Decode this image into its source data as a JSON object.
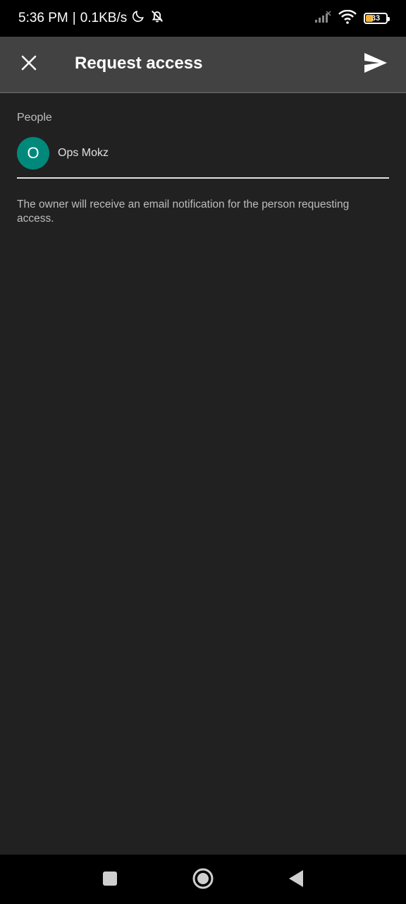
{
  "status_bar": {
    "time": "5:36 PM",
    "separator": "|",
    "network_speed": "0.1KB/s",
    "icons": [
      "moon-icon",
      "bell-off-icon",
      "signal-icon",
      "wifi-icon",
      "battery-icon"
    ],
    "battery_level": "33",
    "battery_color": "#f2b233"
  },
  "app_bar": {
    "title": "Request access",
    "close_icon": "close-icon",
    "send_icon": "send-icon",
    "background": "#424242"
  },
  "people": {
    "section_label": "People",
    "items": [
      {
        "initial": "O",
        "name": "Ops Mokz",
        "avatar_color": "#00897b"
      }
    ]
  },
  "helper_text": "The owner will receive an email notification for the person requesting access.",
  "nav_bar": {
    "buttons": [
      "recent-apps-icon",
      "home-icon",
      "back-icon"
    ]
  }
}
